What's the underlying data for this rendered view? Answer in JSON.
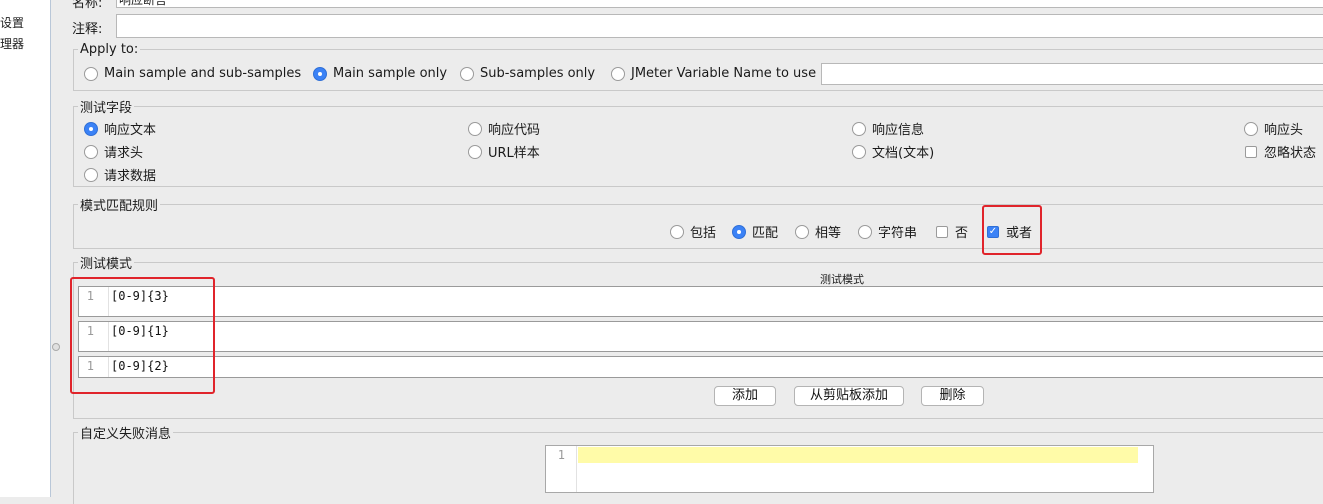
{
  "tree": {
    "item1": "设置",
    "item2": "理器"
  },
  "name_field": {
    "label": "名称:",
    "value": "响应断言"
  },
  "comment_field": {
    "label": "注释:",
    "value": ""
  },
  "apply_to": {
    "legend": "Apply to:",
    "options": [
      "Main sample and sub-samples",
      "Main sample only",
      "Sub-samples only",
      "JMeter Variable Name to use"
    ],
    "selected": "Main sample only",
    "variable_value": ""
  },
  "test_field": {
    "legend": "测试字段",
    "options": [
      "响应文本",
      "响应代码",
      "响应信息",
      "响应头",
      "请求头",
      "URL样本",
      "文档(文本)",
      "请求数据"
    ],
    "ignore_status": "忽略状态",
    "selected": "响应文本"
  },
  "pattern_rules": {
    "legend": "模式匹配规则",
    "options": [
      "包括",
      "匹配",
      "相等",
      "字符串"
    ],
    "selected": "匹配",
    "not_label": "否",
    "or_label": "或者",
    "or_checked": true
  },
  "test_patterns": {
    "legend": "测试模式",
    "column_header": "测试模式",
    "rows": [
      {
        "line": "1",
        "text": "[0-9]{3}"
      },
      {
        "line": "1",
        "text": "[0-9]{1}"
      },
      {
        "line": "1",
        "text": "[0-9]{2}"
      }
    ],
    "buttons": {
      "add": "添加",
      "add_clipboard": "从剪贴板添加",
      "delete": "删除"
    }
  },
  "custom_failure": {
    "legend": "自定义失败消息",
    "line": "1"
  },
  "colors": {
    "accent": "#3b82f6",
    "highlight_box": "#e0242b",
    "editor_line": "#fffba8"
  }
}
